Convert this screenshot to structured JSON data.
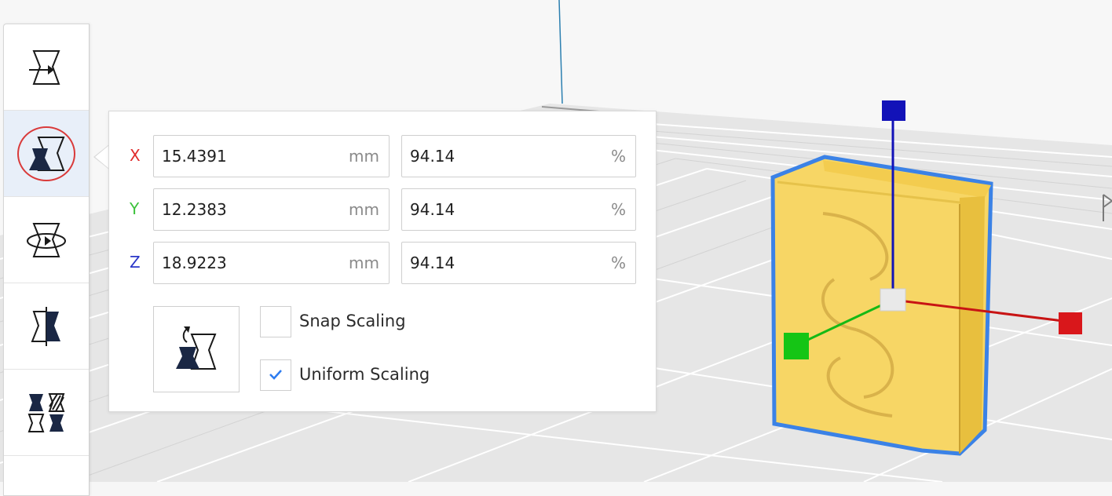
{
  "scale_tool": {
    "rows": [
      {
        "axis": "X",
        "axis_color": "#e02b2b",
        "size_value": "15.4391",
        "size_unit": "mm",
        "percent_value": "94.14",
        "percent_unit": "%"
      },
      {
        "axis": "Y",
        "axis_color": "#3cc23c",
        "size_value": "12.2383",
        "size_unit": "mm",
        "percent_value": "94.14",
        "percent_unit": "%"
      },
      {
        "axis": "Z",
        "axis_color": "#2a36c8",
        "size_value": "18.9223",
        "size_unit": "mm",
        "percent_value": "94.14",
        "percent_unit": "%"
      }
    ],
    "snap_scaling": {
      "label": "Snap Scaling",
      "checked": false
    },
    "uniform_scaling": {
      "label": "Uniform Scaling",
      "checked": true
    },
    "reset_icon": "reset-scale-icon"
  },
  "toolbar": {
    "tools": [
      {
        "name": "move-tool",
        "icon": "move-icon",
        "active": false
      },
      {
        "name": "scale-tool",
        "icon": "scale-icon",
        "active": true
      },
      {
        "name": "rotate-tool",
        "icon": "rotate-icon",
        "active": false
      },
      {
        "name": "mirror-tool",
        "icon": "mirror-icon",
        "active": false
      },
      {
        "name": "per-model-settings-tool",
        "icon": "per-model-settings-icon",
        "active": false
      }
    ]
  },
  "colors": {
    "accent": "#2d7cf0",
    "model": "#f9d96b",
    "gizmo_x": "#d9171b",
    "gizmo_y": "#15c515",
    "gizmo_z": "#1212b8",
    "active_highlight": "#d93a3a"
  }
}
